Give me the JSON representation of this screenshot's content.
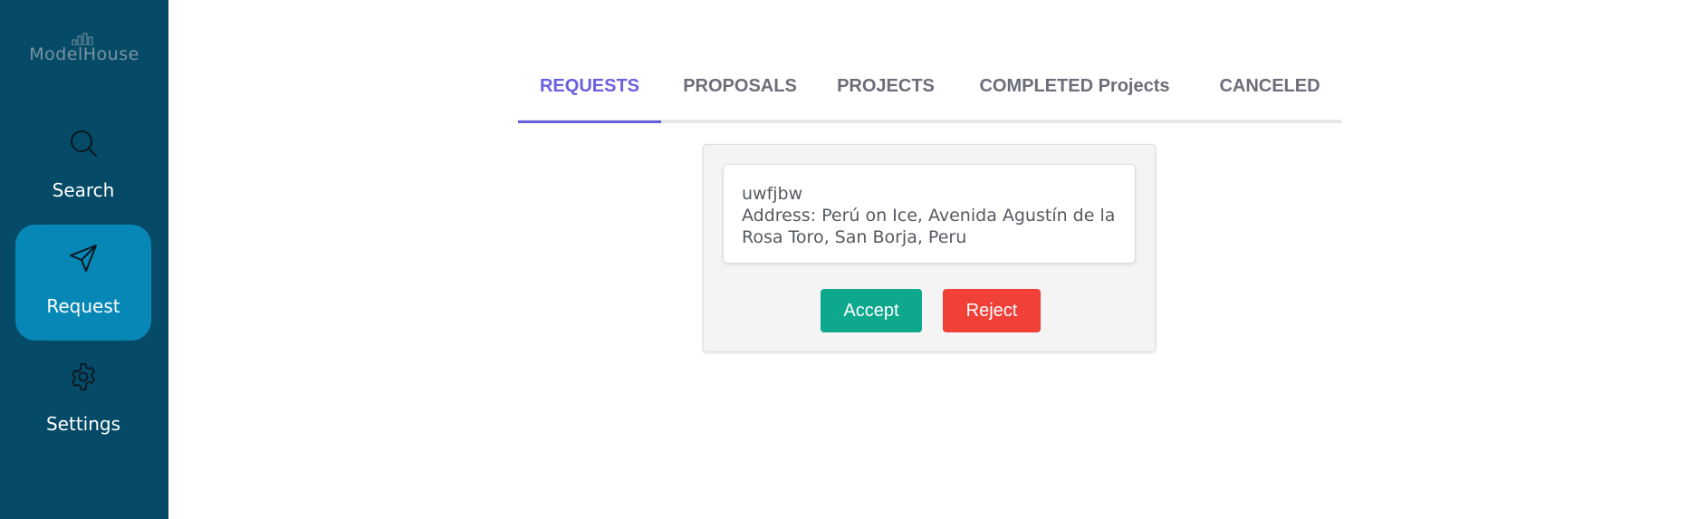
{
  "brand": {
    "name": "ModelHouse"
  },
  "sidebar": {
    "items": [
      {
        "label": "Search",
        "icon": "search-icon",
        "active": false
      },
      {
        "label": "Request",
        "icon": "send-icon",
        "active": true
      },
      {
        "label": "Settings",
        "icon": "gear-icon",
        "active": false
      }
    ]
  },
  "tabs": [
    {
      "label": "REQUESTS",
      "active": true
    },
    {
      "label": "PROPOSALS",
      "active": false
    },
    {
      "label": "PROJECTS",
      "active": false
    },
    {
      "label": "COMPLETED Projects",
      "active": false
    },
    {
      "label": "CANCELED",
      "active": false
    }
  ],
  "requests": [
    {
      "name": "uwfjbw",
      "address": "Address: Perú on Ice, Avenida Agustín de la Rosa Toro, San Borja, Peru",
      "accept_label": "Accept",
      "reject_label": "Reject"
    }
  ],
  "colors": {
    "sidebar_bg": "#054a67",
    "sidebar_active": "#0787b5",
    "tab_active": "#6a5fde",
    "accept": "#0ea88c",
    "reject": "#f04038"
  }
}
